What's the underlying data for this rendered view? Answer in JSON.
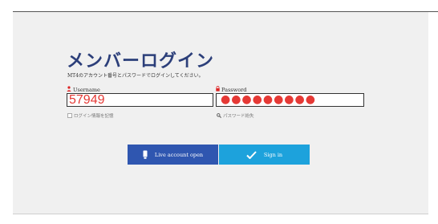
{
  "title": "メンバーログイン",
  "subtitle": "MT4のアカウント番号とパスワードでログインしてください。",
  "username": {
    "label": "Username",
    "value": "57949",
    "icon": "person-icon"
  },
  "password": {
    "label": "Password",
    "masked": "●●●●●●●●●",
    "icon": "lock-icon"
  },
  "remember_label": "ログイン情報を記憶",
  "forgot_label": "パスワード紛失",
  "buttons": {
    "live_account": "Live account open",
    "sign_in": "Sign in"
  },
  "colors": {
    "title": "#2c3f7a",
    "input_text": "#e53935",
    "live_button": "#2f56b0",
    "signin_button": "#1da2dc"
  }
}
